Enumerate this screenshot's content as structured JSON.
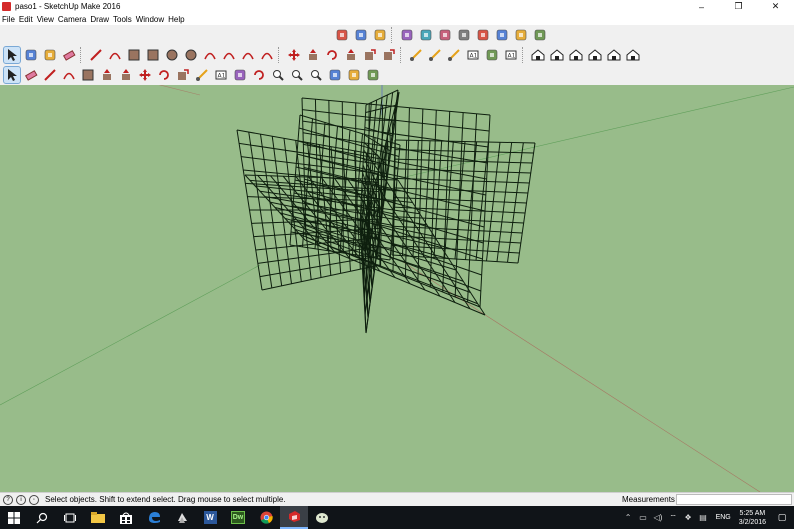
{
  "window": {
    "title": "paso1 - SketchUp Make 2016",
    "minimize": "–",
    "restore": "❐",
    "close": "✕"
  },
  "menu": [
    "File",
    "Edit",
    "View",
    "Camera",
    "Draw",
    "Tools",
    "Window",
    "Help"
  ],
  "toolbar_row1": [
    "component-icon",
    "style-icon",
    "export-icon",
    "sep",
    "section-icon",
    "solid-icon",
    "warehouse-icon",
    "extension-icon",
    "layout-icon",
    "share-icon",
    "photo-icon",
    "sandbox-icon"
  ],
  "toolbar_row2": [
    "select-icon",
    "component-icon",
    "paint-bucket-icon",
    "eraser-icon",
    "sep",
    "pencil-icon",
    "freehand-icon",
    "rectangle-icon",
    "rotated-rect-icon",
    "circle-icon",
    "polygon-icon",
    "arc-icon",
    "arc2-icon",
    "arc3-icon",
    "pie-icon",
    "sep",
    "move-icon",
    "pushpull-icon",
    "rotate-icon",
    "followme-icon",
    "scale-icon",
    "offset-icon",
    "sep",
    "tape-icon",
    "dimension-icon",
    "protractor-icon",
    "text-icon",
    "axes-icon",
    "3dtext-icon",
    "sep",
    "iso-icon",
    "top-icon",
    "front-icon",
    "right-icon",
    "back-icon",
    "left-icon"
  ],
  "toolbar_row3": [
    "select-icon",
    "eraser-icon",
    "line-icon",
    "arc-icon",
    "rectangle-icon",
    "pushpull-icon",
    "followme-icon",
    "move-icon",
    "rotate-icon",
    "scale-icon",
    "tape-icon",
    "text-icon",
    "paint-icon",
    "orbit-icon",
    "pan-icon",
    "zoom-icon",
    "zoom-extents-icon",
    "warehouse-icon",
    "share-model-icon",
    "extension-warehouse-icon"
  ],
  "status": {
    "message": "Select objects. Shift to extend select. Drag mouse to select multiple.",
    "measurements_label": "Measurements"
  },
  "taskbar": {
    "apps": [
      "windows-start-icon",
      "search-icon",
      "task-view-icon",
      "file-explorer-icon",
      "store-icon",
      "edge-icon",
      "app-icon",
      "word-icon",
      "dreamweaver-icon",
      "chrome-icon",
      "sketchup-icon",
      "chat-icon"
    ],
    "active_app": "sketchup-icon",
    "word_label": "W",
    "dw_label": "Dw",
    "lang": "ENG",
    "time": "5:25 AM",
    "date": "3/2/2016"
  },
  "colors": {
    "viewport_bg": "#98bc8a",
    "axis_red": "#c04848",
    "axis_green": "#3c8c3c",
    "axis_blue": "#6070c0",
    "wire": "#0e1f0e"
  }
}
